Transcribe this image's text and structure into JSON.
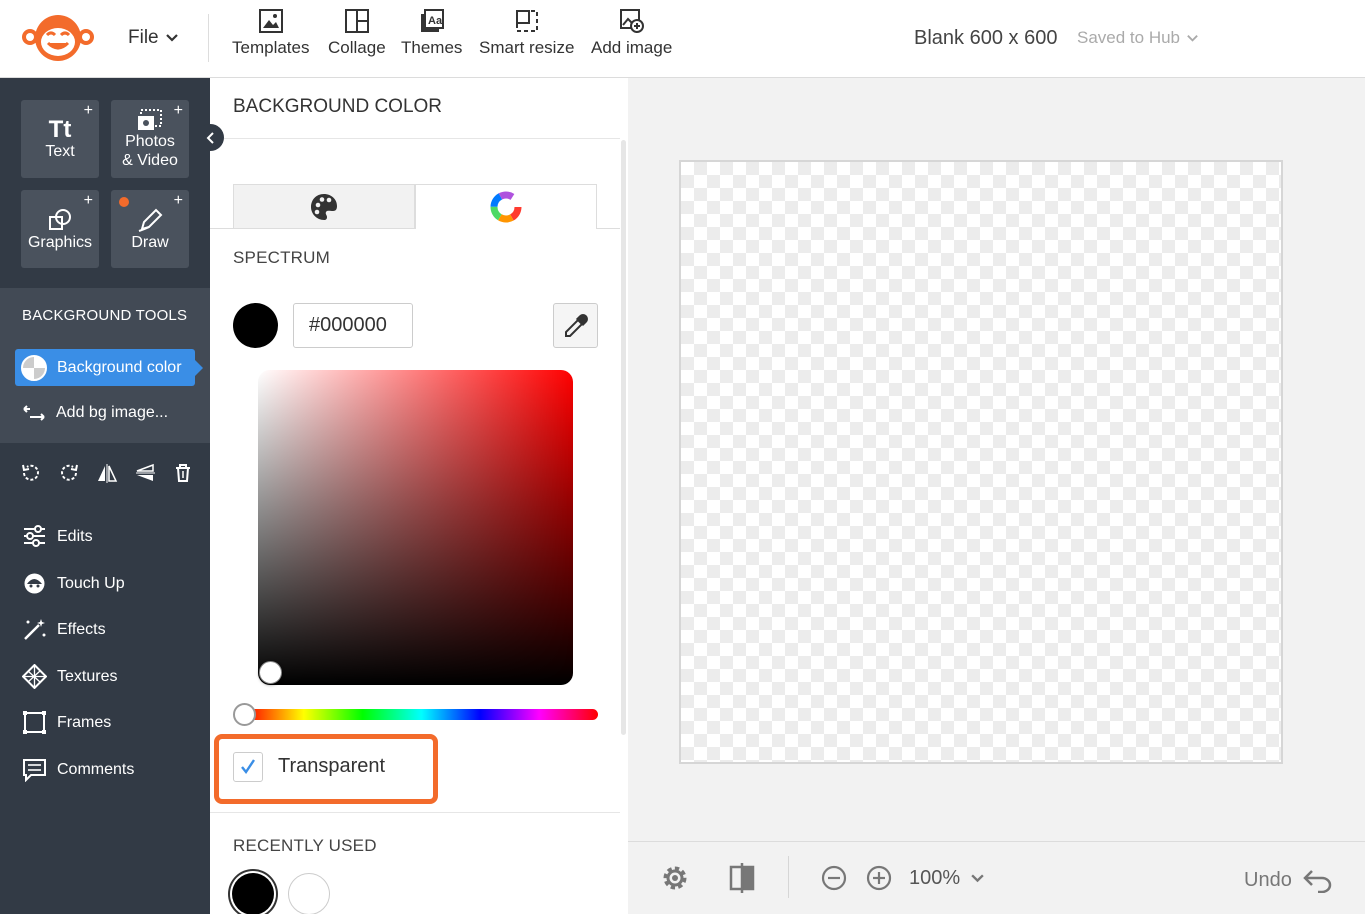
{
  "topbar": {
    "file_label": "File",
    "tools": [
      {
        "label": "Templates",
        "icon": "image-icon"
      },
      {
        "label": "Collage",
        "icon": "collage-icon"
      },
      {
        "label": "Themes",
        "icon": "themes-icon"
      },
      {
        "label": "Smart resize",
        "icon": "resize-icon"
      },
      {
        "label": "Add image",
        "icon": "add-image-icon"
      }
    ],
    "doc_title": "Blank 600 x 600",
    "saved_status": "Saved to Hub"
  },
  "sidebar": {
    "tiles": [
      {
        "glyph": "Tt",
        "label": "Text"
      },
      {
        "label": "Photos & Video"
      },
      {
        "label": "Graphics"
      },
      {
        "label": "Draw"
      }
    ],
    "bg_tools_title": "BACKGROUND TOOLS",
    "bg_color_label": "Background color",
    "add_bg_label": "Add bg image...",
    "nav": [
      {
        "label": "Edits"
      },
      {
        "label": "Touch Up"
      },
      {
        "label": "Effects"
      },
      {
        "label": "Textures"
      },
      {
        "label": "Frames"
      },
      {
        "label": "Comments"
      }
    ]
  },
  "panel": {
    "title": "BACKGROUND COLOR",
    "spectrum_label": "SPECTRUM",
    "hex_value": "#000000",
    "selected_color": "#000000",
    "transparent_label": "Transparent",
    "transparent_checked": true,
    "recently_used_label": "RECENTLY USED",
    "recent_colors": [
      "#000000",
      "#ffffff"
    ]
  },
  "bottombar": {
    "zoom": "100%",
    "undo_label": "Undo"
  },
  "colors": {
    "accent": "#3a8ee6",
    "highlight": "#f36b2b",
    "sidebar_bg": "#323a45"
  }
}
